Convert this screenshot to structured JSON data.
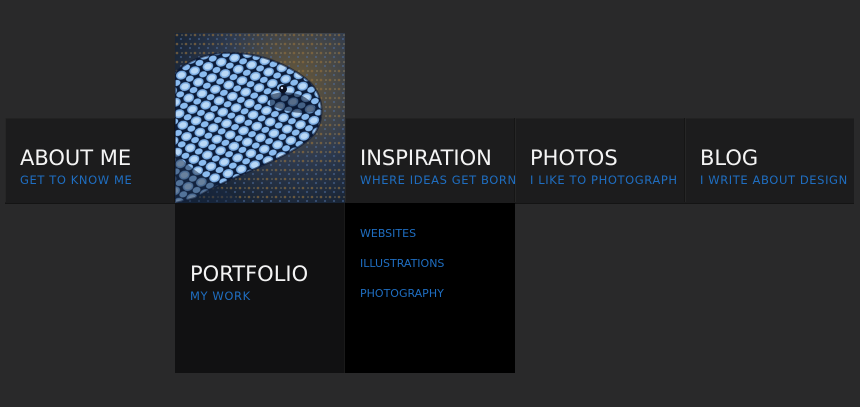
{
  "nav": {
    "about": {
      "title": "ABOUT ME",
      "subtitle": "GET TO KNOW ME"
    },
    "portfolio": {
      "title": "PORTFOLIO",
      "subtitle": "MY WORK",
      "image_alt": "moray eel photo"
    },
    "inspiration": {
      "title": "INSPIRATION",
      "subtitle": "WHERE IDEAS GET BORN",
      "submenu": [
        "WEBSITES",
        "ILLUSTRATIONS",
        "PHOTOGRAPHY"
      ]
    },
    "photos": {
      "title": "PHOTOS",
      "subtitle": "I LIKE TO PHOTOGRAPH"
    },
    "blog": {
      "title": "BLOG",
      "subtitle": "I WRITE ABOUT DESIGN"
    }
  },
  "colors": {
    "background": "#29292a",
    "bar": "#1c1c1d",
    "accent": "#1f6ec1",
    "title_text": "#f4f4f4",
    "dropdown_bg": "#000000"
  }
}
